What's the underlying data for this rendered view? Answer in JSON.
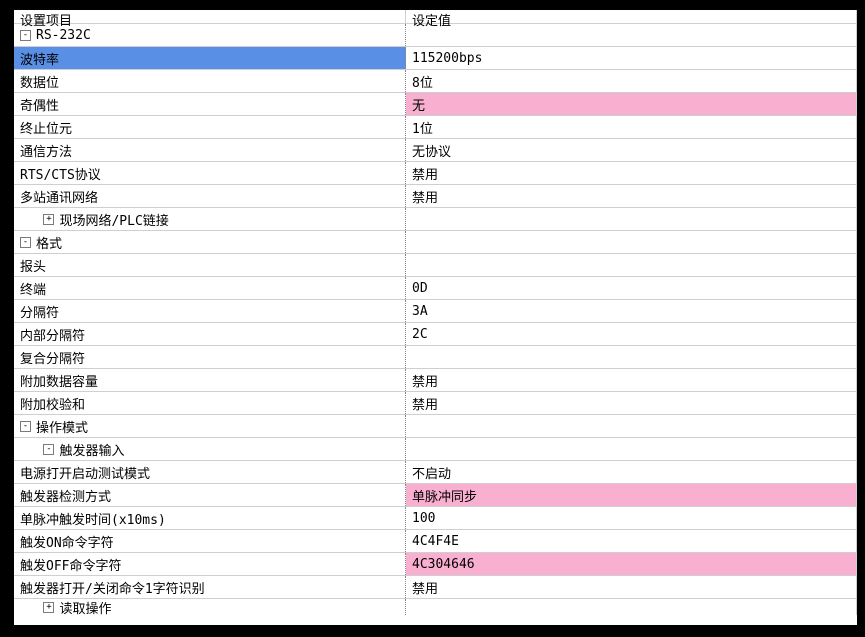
{
  "header": {
    "name": "设置项目",
    "value": "设定值"
  },
  "groups": [
    {
      "key": "rs232c",
      "label": "RS-232C",
      "collapsed": false,
      "items": [
        {
          "key": "baud",
          "label": "波特率",
          "value": "115200bps",
          "selected": true
        },
        {
          "key": "databits",
          "label": "数据位",
          "value": "8位"
        },
        {
          "key": "parity",
          "label": "奇偶性",
          "value": "无",
          "highlight": true
        },
        {
          "key": "stopbits",
          "label": "终止位元",
          "value": "1位"
        },
        {
          "key": "commmethod",
          "label": "通信方法",
          "value": "无协议"
        },
        {
          "key": "rtscts",
          "label": "RTS/CTS协议",
          "value": "禁用"
        },
        {
          "key": "multistation",
          "label": "多站通讯网络",
          "value": "禁用"
        }
      ]
    },
    {
      "key": "fieldnet",
      "label": "现场网络/PLC链接",
      "collapsed": true,
      "items": []
    },
    {
      "key": "format",
      "label": "格式",
      "collapsed": false,
      "items": [
        {
          "key": "header",
          "label": "报头",
          "value": ""
        },
        {
          "key": "terminator",
          "label": "终端",
          "value": "0D"
        },
        {
          "key": "delimiter",
          "label": "分隔符",
          "value": "3A"
        },
        {
          "key": "innerdel",
          "label": "内部分隔符",
          "value": "2C"
        },
        {
          "key": "composite",
          "label": "复合分隔符",
          "value": ""
        },
        {
          "key": "appenddata",
          "label": "附加数据容量",
          "value": "禁用"
        },
        {
          "key": "appendcrc",
          "label": "附加校验和",
          "value": "禁用"
        }
      ]
    },
    {
      "key": "opmode",
      "label": "操作模式",
      "collapsed": false,
      "subgroups": [
        {
          "key": "trigin",
          "label": "触发器输入",
          "collapsed": false,
          "items": [
            {
              "key": "powertest",
              "label": "电源打开启动测试模式",
              "value": "不启动"
            },
            {
              "key": "trigdet",
              "label": "触发器检测方式",
              "value": "单脉冲同步",
              "highlight": true
            },
            {
              "key": "pulsetime",
              "label": "单脉冲触发时间(x10ms)",
              "value": "100"
            },
            {
              "key": "trigon",
              "label": "触发ON命令字符",
              "value": "4C4F4E"
            },
            {
              "key": "trigoff",
              "label": "触发OFF命令字符",
              "value": "4C304646",
              "highlight": true
            },
            {
              "key": "trig1char",
              "label": "触发器打开/关闭命令1字符识别",
              "value": "禁用"
            }
          ]
        },
        {
          "key": "readop",
          "label": "读取操作",
          "collapsed": true,
          "items": []
        }
      ]
    }
  ]
}
